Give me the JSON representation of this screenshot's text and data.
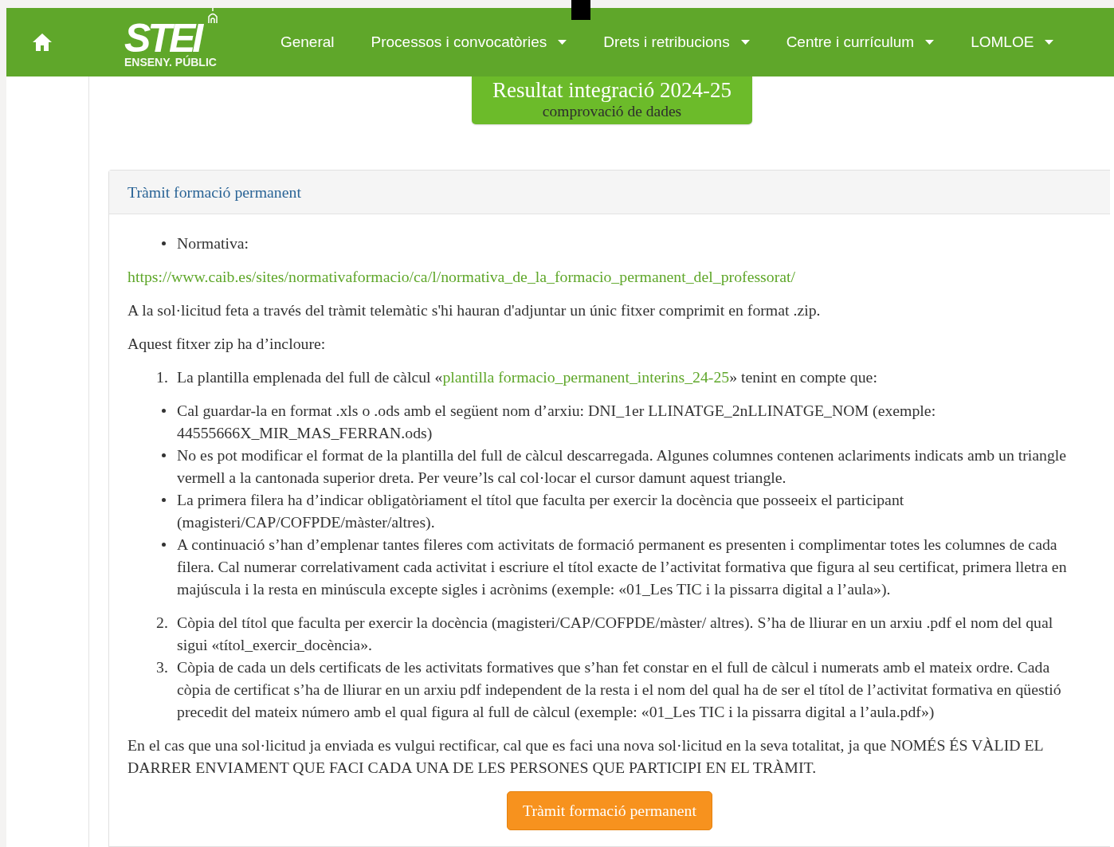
{
  "navbar": {
    "logo": {
      "text": "STEI",
      "subtitle": "ENSENY. PÚBLIC"
    },
    "items": [
      {
        "label": "General",
        "dropdown": false
      },
      {
        "label": "Processos i convocatòries",
        "dropdown": true
      },
      {
        "label": "Drets i retribucions",
        "dropdown": true
      },
      {
        "label": "Centre i currículum",
        "dropdown": true
      },
      {
        "label": "LOMLOE",
        "dropdown": true
      }
    ]
  },
  "banner_button": {
    "title": "Resultat integració 2024-25",
    "subtitle": "comprovació de dades"
  },
  "panel": {
    "title": "Tràmit formació permanent",
    "blocks": [
      {
        "kind": "bullets",
        "items": [
          "Normativa:"
        ]
      },
      {
        "kind": "link",
        "text": "https://www.caib.es/sites/normativaformacio/ca/l/normativa_de_la_formacio_permanent_del_professorat/"
      },
      {
        "kind": "paragraph",
        "text": "A la sol·licitud feta a través del tràmit telemàtic s'hi hauran d'adjuntar un únic fitxer comprimit en format .zip."
      },
      {
        "kind": "paragraph",
        "text": "Aquest fitxer zip ha d’incloure:"
      },
      {
        "kind": "numbered",
        "items": [
          {
            "number": "1.",
            "parts": [
              {
                "text": "La plantilla emplenada del full de càlcul «",
                "link": false
              },
              {
                "text": "plantilla formacio_permanent_interins_24-25",
                "link": true
              },
              {
                "text": "» tenint en compte que:",
                "link": false
              }
            ]
          }
        ]
      },
      {
        "kind": "bullets",
        "items": [
          "Cal guardar-la en format .xls o .ods amb el següent nom d’arxiu: DNI_1er LLINATGE_2nLLINATGE_NOM (exemple: 44555666X_MIR_MAS_FERRAN.ods)",
          "No es pot modificar el format de la plantilla del full de càlcul descarregada. Algunes columnes contenen aclariments indicats amb un triangle vermell a la cantonada superior dreta. Per veure’ls cal col·locar el cursor damunt aquest triangle.",
          "La primera filera ha d’indicar obligatòriament el títol que faculta per exercir la docència que posseeix el participant (magisteri/CAP/COFPDE/màster/altres).",
          "A continuació s’han d’emplenar tantes fileres com activitats de formació permanent es presenten i complimentar totes les columnes de cada filera. Cal numerar correlativament cada activitat i escriure el títol exacte de l’activitat formativa que figura al seu certificat, primera lletra en majúscula i la resta en minúscula excepte sigles i acrònims (exemple: «01_Les TIC i la pissarra digital a l’aula»)."
        ]
      },
      {
        "kind": "numbered",
        "items": [
          {
            "number": "2.",
            "parts": [
              {
                "text": "Còpia del títol que faculta per exercir la docència (magisteri/CAP/COFPDE/màster/ altres). S’ha de lliurar en un arxiu .pdf el nom del qual sigui «títol_exercir_docència».",
                "link": false
              }
            ]
          },
          {
            "number": "3.",
            "parts": [
              {
                "text": "Còpia de cada un dels certificats de les activitats formatives que s’han fet constar en el full de càlcul i numerats amb el mateix ordre. Cada còpia de certificat s’ha de lliurar en un arxiu pdf independent de la resta i el nom del qual ha de ser el títol de l’activitat formativa en qüestió precedit del mateix número amb el qual figura al full de càlcul (exemple: «01_Les TIC i la pissarra digital a l’aula.pdf»)",
                "link": false
              }
            ]
          }
        ]
      },
      {
        "kind": "paragraph",
        "text": "En el cas que una sol·licitud ja enviada es vulgui rectificar, cal que es faci una nova sol·licitud en la seva totalitat, ja que NOMÉS ÉS VÀLID EL DARRER ENVIAMENT QUE FACI CADA UNA DE LES PERSONES QUE PARTICIPI EN EL TRÀMIT."
      }
    ],
    "action_button": "Tràmit formació permanent"
  }
}
